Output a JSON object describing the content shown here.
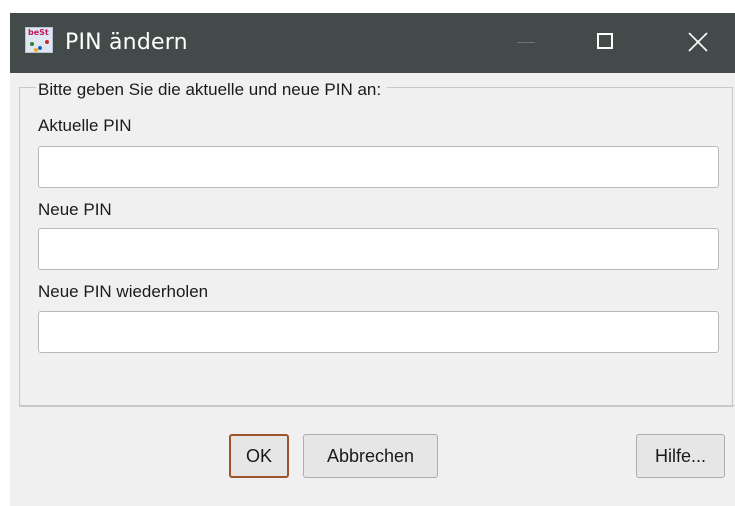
{
  "window": {
    "title": "PIN ändern",
    "app_icon_label": "beSt",
    "titlebar_color": "#424b4a"
  },
  "form": {
    "legend": "Bitte geben Sie die aktuelle und neue PIN an:",
    "fields": [
      {
        "label": "Aktuelle PIN",
        "value": ""
      },
      {
        "label": "Neue PIN",
        "value": ""
      },
      {
        "label": "Neue PIN wiederholen",
        "value": ""
      }
    ]
  },
  "buttons": {
    "ok": "OK",
    "cancel": "Abbrechen",
    "help": "Hilfe..."
  },
  "icons": {
    "minimize": "minimize-icon",
    "maximize": "maximize-icon",
    "close": "close-icon"
  },
  "colors": {
    "default_button_border": "#a0522d",
    "dialog_background": "#f0f0f0"
  }
}
